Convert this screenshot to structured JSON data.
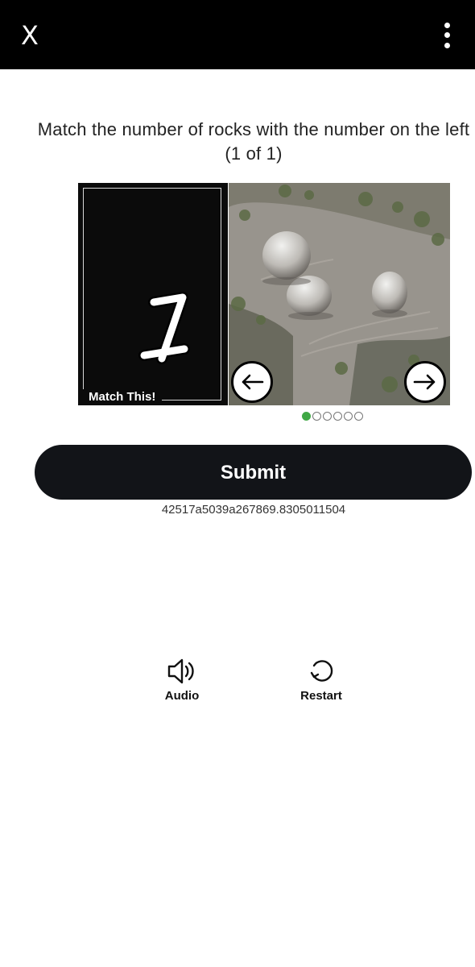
{
  "topbar": {
    "close_label": "X",
    "close_icon": "close-icon",
    "more_icon": "more-vertical-icon"
  },
  "challenge": {
    "instruction": "Match the number of rocks with the number on the left (1 of 1)",
    "target_number": "1",
    "match_label": "Match This!",
    "image_index_selected": 1,
    "image_count": 6,
    "prev_icon": "arrow-left-icon",
    "next_icon": "arrow-right-icon"
  },
  "submit": {
    "label": "Submit"
  },
  "session_id": "42517a5039a267869.8305011504",
  "tools": {
    "audio_label": "Audio",
    "audio_icon": "speaker-icon",
    "restart_label": "Restart",
    "restart_icon": "refresh-icon"
  },
  "colors": {
    "topbar": "#000000",
    "submit_bg": "#121418",
    "active_dot": "#3fa845"
  }
}
